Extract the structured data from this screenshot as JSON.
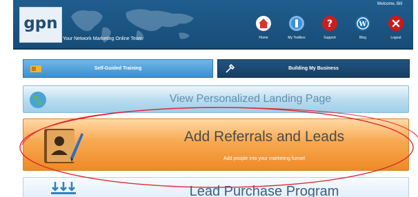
{
  "header": {
    "logo_text": "gpn",
    "tagline": "Your Network Marketing Online Team",
    "welcome": "Welcome, Bill",
    "nav": [
      {
        "label": "Home",
        "icon": "home-icon",
        "color": "#d9342b"
      },
      {
        "label": "My Toolbox",
        "icon": "toolbox-icon",
        "color": "#3f8fd6"
      },
      {
        "label": "Support",
        "icon": "support-icon",
        "color": "#c82020"
      },
      {
        "label": "Blog",
        "icon": "wordpress-icon",
        "color": "#1d6ba8"
      },
      {
        "label": "Logout",
        "icon": "logout-icon",
        "color": "#d01818"
      }
    ]
  },
  "tabs": {
    "guided": "Self-Guided Training",
    "business": "Building My Business"
  },
  "actions": {
    "landing": "View Personalized Landing Page",
    "referrals_title": "Add Referrals and Leads",
    "referrals_sub": "Add people into your marketing funnel",
    "purchase": "Lead Purchase Program"
  },
  "colors": {
    "header": "#1f5d8e",
    "tab_guided": "#4a9bd8",
    "tab_business": "#1c4a72",
    "referrals": "#f29a3c",
    "annotation": "#e0282f"
  }
}
